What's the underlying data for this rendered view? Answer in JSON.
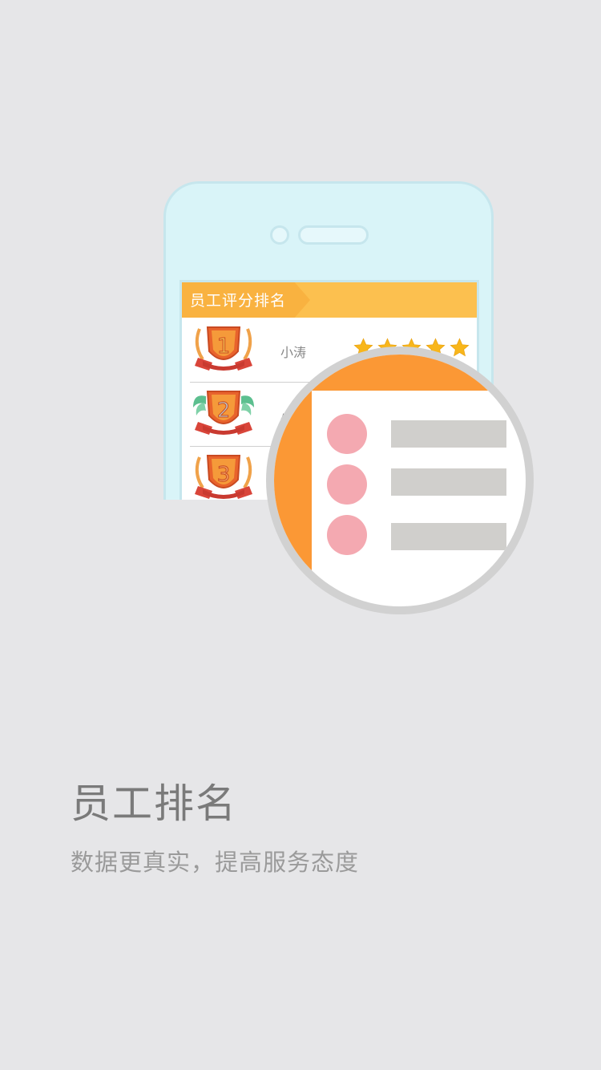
{
  "screen": {
    "header_title": "员工评分排名",
    "rows": [
      {
        "rank": "1",
        "name": "小涛",
        "stars": 5
      },
      {
        "rank": "2",
        "name": "小",
        "stars": 0
      },
      {
        "rank": "3",
        "name": "",
        "stars": 0
      }
    ]
  },
  "caption": {
    "title": "员工排名",
    "subtitle": "数据更真实，提高服务态度"
  },
  "icons": {
    "medal_first": "medal-icon",
    "medal_second": "medal-icon",
    "medal_third": "medal-icon",
    "star": "star-icon",
    "magnifier": "magnifier-icon"
  },
  "colors": {
    "background": "#e6e6e8",
    "phone": "#d9f4f8",
    "header": "#fcc04f",
    "accent_orange": "#fb9835",
    "dot_pink": "#f4a9b1",
    "bar_gray": "#d0cfcc",
    "star_yellow": "#f8b61b"
  }
}
